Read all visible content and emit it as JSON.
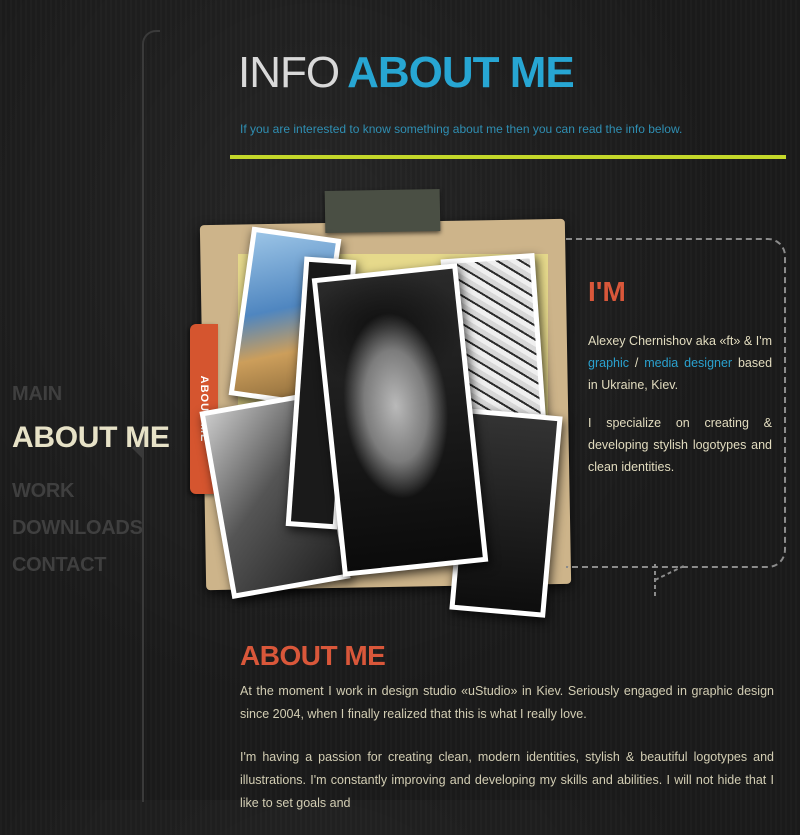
{
  "nav": {
    "items": [
      {
        "label": "MAIN",
        "active": false
      },
      {
        "label": "ABOUT ME",
        "active": true
      },
      {
        "label": "WORK",
        "active": false
      },
      {
        "label": "DOWNLOADS",
        "active": false
      },
      {
        "label": "CONTACT",
        "active": false
      }
    ]
  },
  "header": {
    "title_light": "INFO",
    "title_accent": "ABOUT ME",
    "subtitle": "If you are interested to know something about me then you can read the info below."
  },
  "folder": {
    "tab_label": "ABOUT ME"
  },
  "intro": {
    "title": "I'M",
    "line1_prefix": "Alexey Chernishov aka «ft» & I'm",
    "link_graphic": "graphic",
    "slash": " / ",
    "link_media": "media designer",
    "line1_suffix": " based in Ukraine, Kiev.",
    "paragraph2": "I specialize on creating & developing stylish logotypes and clean identities."
  },
  "about": {
    "title": "ABOUT ME",
    "paragraph1": "At the moment I work in design studio «uStudio» in Kiev. Seriously engaged in graphic design since 2004, when I finally realized that this is what I really love.",
    "paragraph2": "I'm having a passion for creating clean, modern identities, stylish & beautiful logotypes and illustrations. I'm constantly improving and developing my skills and abilities. I will not hide that I like to set goals and"
  },
  "colors": {
    "accent_blue": "#27a6d3",
    "accent_orange": "#d9573a",
    "rule_lime": "#c4d82a",
    "nav_inactive": "#3f3f3f",
    "nav_active": "#e7e2c7"
  }
}
